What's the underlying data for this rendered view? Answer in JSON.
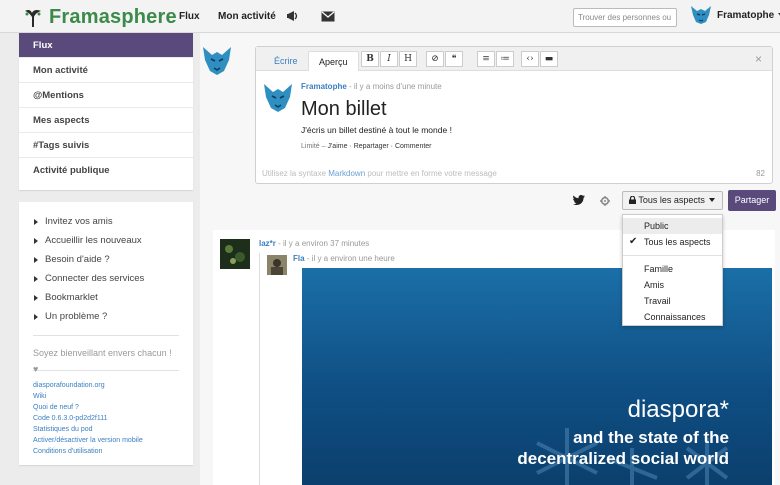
{
  "colors": {
    "brand": "#3b8a4a",
    "accent": "#5a4a7c",
    "link": "#3a7fc1"
  },
  "topbar": {
    "brand": "Framasphere",
    "nav": [
      {
        "label": "Flux"
      },
      {
        "label": "Mon activité"
      }
    ],
    "icons": [
      "megaphone-icon",
      "envelope-icon"
    ],
    "search_placeholder": "Trouver des personnes ou",
    "user_name": "Framatophe"
  },
  "sidebar": {
    "items": [
      {
        "label": "Flux",
        "active": true
      },
      {
        "label": "Mon activité"
      },
      {
        "label": "@Mentions"
      },
      {
        "label": "Mes aspects"
      },
      {
        "label": "#Tags suivis"
      },
      {
        "label": "Activité publique"
      }
    ],
    "links": [
      "Invitez vos amis",
      "Accueillir les nouveaux",
      "Besoin d'aide ?",
      "Connecter des services",
      "Bookmarklet",
      "Un problème ?"
    ],
    "kindness": "Soyez bienveillant envers chacun ! ♥",
    "footer": [
      "diasporafoundation.org",
      "Wiki",
      "Quoi de neuf ?",
      "Code 0.6.3.0-pd2d2f111",
      "Statistiques du pod",
      "Activer/désactiver la version mobile",
      "Conditions d'utilisation"
    ]
  },
  "publisher": {
    "tab_write": "Écrire",
    "tab_preview": "Aperçu",
    "format_buttons": [
      "B",
      "I",
      "H",
      "⊘",
      "❝",
      "≡",
      "≔",
      "‹›",
      "▬"
    ],
    "close": "×",
    "preview": {
      "author": "Framatophe",
      "time": " - il y a moins d'une minute",
      "title": "Mon billet",
      "body": "J'écris un billet destiné à tout le monde !",
      "meta_prefix": "Limité – ",
      "meta_actions": "J'aime · Repartager · Commenter"
    },
    "hint_before": "Utilisez la syntaxe ",
    "hint_link": "Markdown",
    "hint_after": " pour mettre en forme votre message",
    "char_count": "82"
  },
  "controls": {
    "aspect_label": "Tous les aspects",
    "share_label": "Partager"
  },
  "aspect_menu": {
    "items": [
      {
        "label": "Public",
        "checked": false
      },
      {
        "label": "Tous les aspects",
        "checked": true
      },
      {
        "label": "Famille",
        "checked": false
      },
      {
        "label": "Amis",
        "checked": false
      },
      {
        "label": "Travail",
        "checked": false
      },
      {
        "label": "Connaissances",
        "checked": false
      }
    ]
  },
  "post": {
    "author": "laz*r",
    "time": " - il y a environ 37 minutes",
    "reshare_author": "Fla",
    "reshare_time": " - il y a environ une heure",
    "banner_title": "diaspora*",
    "banner_line1": "and the state of the",
    "banner_line2": "decentralized social world"
  }
}
